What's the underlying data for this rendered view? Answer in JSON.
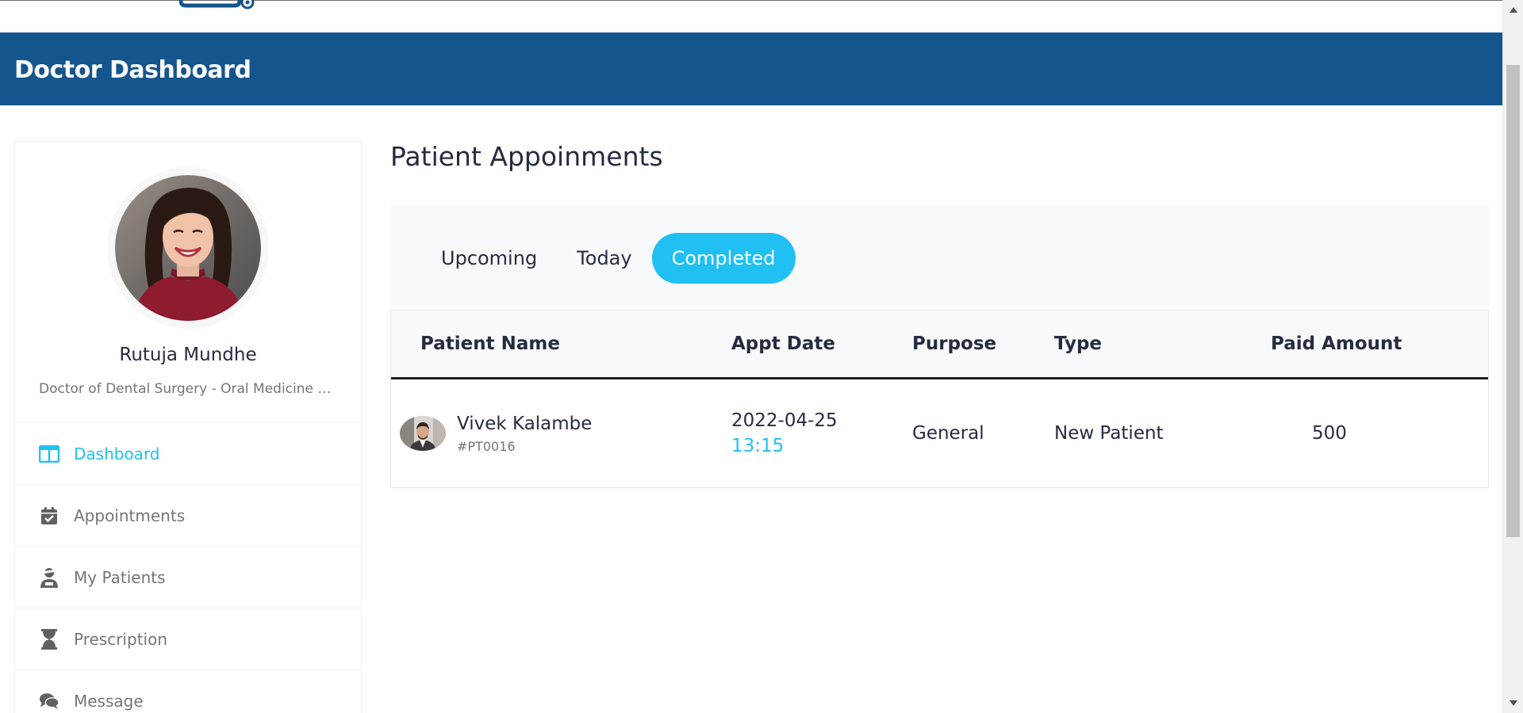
{
  "header": {
    "title": "Doctor Dashboard"
  },
  "profile": {
    "name": "Rutuja Mundhe",
    "degree": "Doctor of Dental Surgery - Oral Medicine and Radiology"
  },
  "sidebar": {
    "items": [
      {
        "label": "Dashboard",
        "icon": "columns-icon",
        "active": true
      },
      {
        "label": "Appointments",
        "icon": "calendar-check-icon",
        "active": false
      },
      {
        "label": "My Patients",
        "icon": "user-injured-icon",
        "active": false
      },
      {
        "label": "Prescription",
        "icon": "hourglass-icon",
        "active": false
      },
      {
        "label": "Message",
        "icon": "comments-icon",
        "active": false
      }
    ]
  },
  "main": {
    "title": "Patient Appoinments",
    "tabs": [
      {
        "label": "Upcoming",
        "active": false
      },
      {
        "label": "Today",
        "active": false
      },
      {
        "label": "Completed",
        "active": true
      }
    ],
    "table": {
      "headers": [
        "Patient Name",
        "Appt Date",
        "Purpose",
        "Type",
        "Paid Amount"
      ],
      "rows": [
        {
          "patient_name": "Vivek Kalambe",
          "patient_id": "#PT0016",
          "date": "2022-04-25",
          "time": "13:15",
          "purpose": "General",
          "type": "New Patient",
          "paid_amount": "500"
        }
      ]
    }
  },
  "colors": {
    "header_bg": "#15558d",
    "accent": "#20c0f3",
    "text": "#272b41",
    "muted": "#757575"
  }
}
